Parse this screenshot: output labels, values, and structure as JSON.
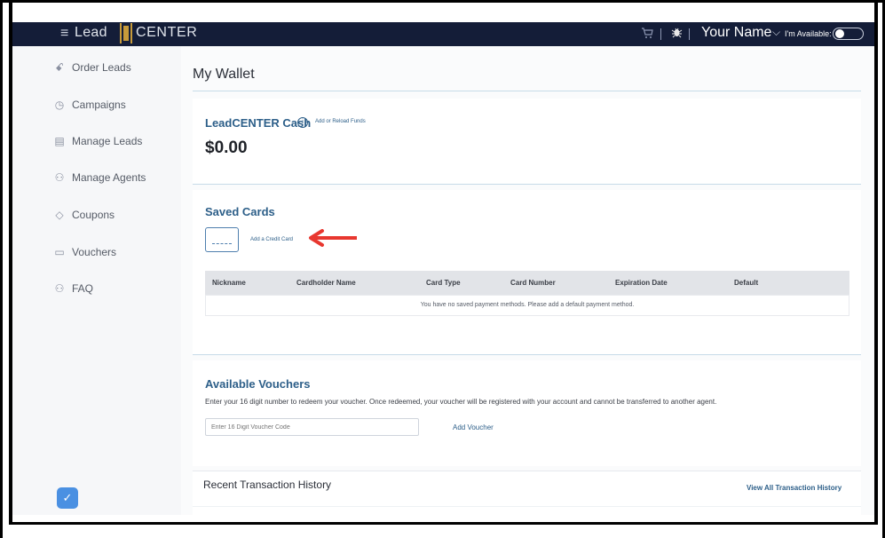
{
  "topbar": {
    "brand_part1": "Lead",
    "brand_part2": "CENTER",
    "user_name": "Your Name",
    "availability_label": "I'm Available:",
    "hamburger": "≡",
    "chevron": "⌵",
    "cart_icon": "cart-icon",
    "bug_icon": "bug-icon"
  },
  "sidebar": {
    "items": [
      {
        "label": "Order Leads",
        "icon": "users-icon",
        "glyph": "ꗃ"
      },
      {
        "label": "Campaigns",
        "icon": "clock-icon",
        "glyph": "◷"
      },
      {
        "label": "Manage Leads",
        "icon": "id-card-icon",
        "glyph": "▤"
      },
      {
        "label": "Manage Agents",
        "icon": "agents-icon",
        "glyph": "⚇"
      },
      {
        "label": "Coupons",
        "icon": "tag-icon",
        "glyph": "◇"
      },
      {
        "label": "Vouchers",
        "icon": "ticket-icon",
        "glyph": "▭"
      },
      {
        "label": "FAQ",
        "icon": "people-icon",
        "glyph": "⚇"
      }
    ],
    "shield_glyph": "✓"
  },
  "main": {
    "page_title": "My Wallet",
    "cash": {
      "title": "LeadCENTER Cash",
      "info_glyph": "i",
      "reload_link": "Add or Reload Funds",
      "balance": "$0.00"
    },
    "saved_cards": {
      "title": "Saved Cards",
      "add_card_link": "Add a Credit Card",
      "columns": [
        "Nickname",
        "Cardholder Name",
        "Card Type",
        "Card Number",
        "Expiration Date",
        "Default"
      ],
      "empty_message": "You have no saved payment methods. Please add a default payment method."
    },
    "vouchers": {
      "title": "Available Vouchers",
      "description": "Enter your 16 digit number to redeem your voucher. Once redeemed, your voucher will be registered with your account and cannot be transferred to another agent.",
      "input_placeholder": "Enter 16 Digit Voucher Code",
      "add_button": "Add Voucher"
    },
    "transactions": {
      "title": "Recent Transaction History",
      "view_all": "View All Transaction History"
    }
  },
  "colors": {
    "topbar_bg": "#141d38",
    "accent_blue": "#2d5f89",
    "brand_gold": "#c79a3a",
    "annotation_arrow": "#e8372f"
  }
}
